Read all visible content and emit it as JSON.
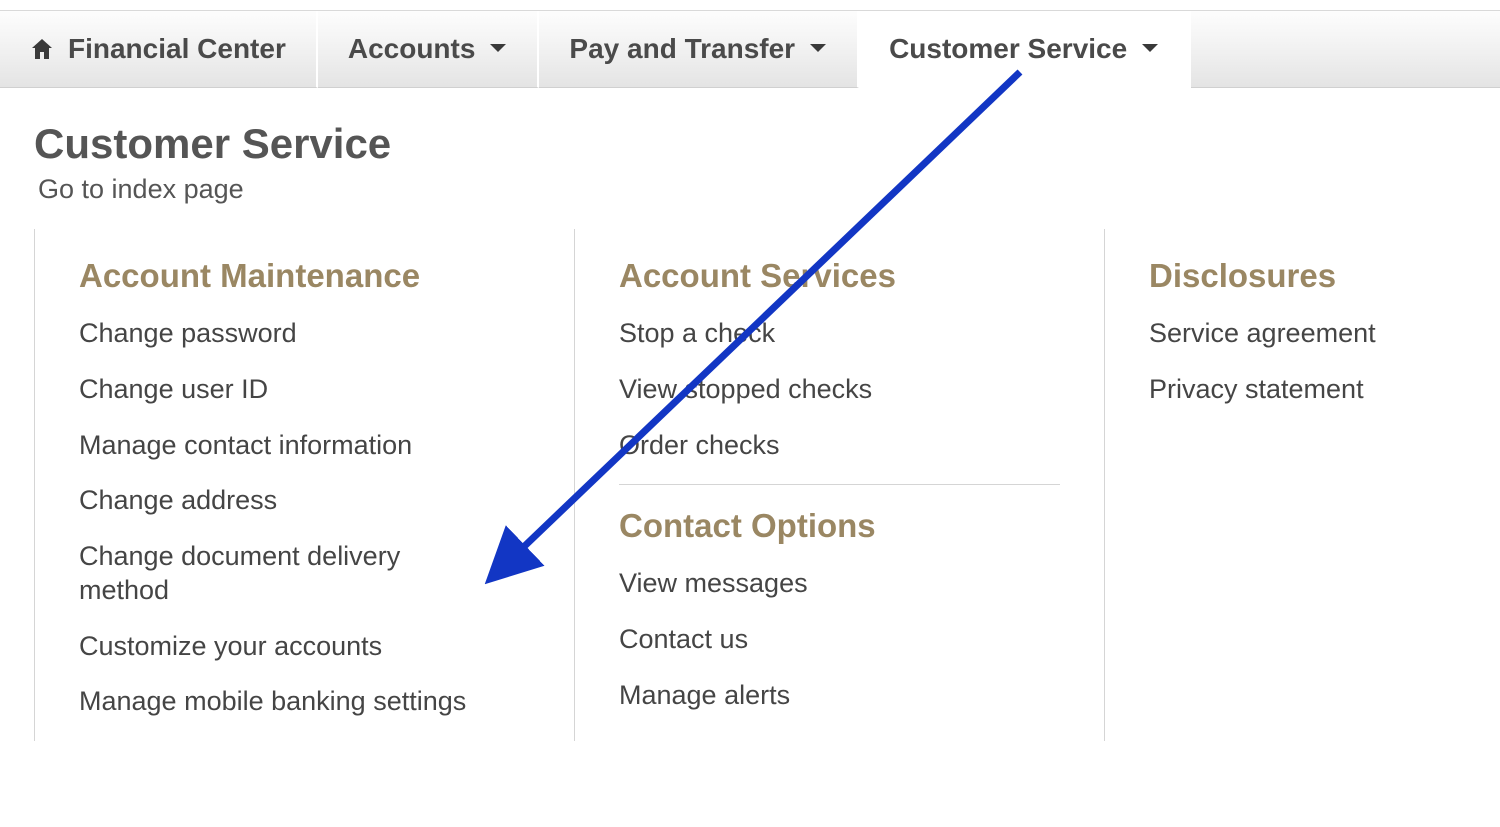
{
  "nav": {
    "tabs": [
      {
        "label": "Financial Center",
        "hasHome": true,
        "hasCaret": false,
        "active": false
      },
      {
        "label": "Accounts",
        "hasHome": false,
        "hasCaret": true,
        "active": false
      },
      {
        "label": "Pay and Transfer",
        "hasHome": false,
        "hasCaret": true,
        "active": false
      },
      {
        "label": "Customer Service",
        "hasHome": false,
        "hasCaret": true,
        "active": true
      }
    ]
  },
  "page": {
    "title": "Customer Service",
    "index_link": "Go to index page"
  },
  "sections": {
    "account_maintenance": {
      "heading": "Account Maintenance",
      "items": [
        "Change password",
        "Change user ID",
        "Manage contact information",
        "Change address",
        "Change document delivery method",
        "Customize your accounts",
        "Manage mobile banking settings"
      ]
    },
    "account_services": {
      "heading": "Account Services",
      "items": [
        "Stop a check",
        "View stopped checks",
        "Order checks"
      ]
    },
    "contact_options": {
      "heading": "Contact Options",
      "items": [
        "View messages",
        "Contact us",
        "Manage alerts"
      ]
    },
    "disclosures": {
      "heading": "Disclosures",
      "items": [
        "Service agreement",
        "Privacy statement"
      ]
    }
  },
  "annotation": {
    "arrow_color": "#1236c4",
    "from_tab_index": 3,
    "to_section": "account_maintenance",
    "to_item_index": 4
  }
}
